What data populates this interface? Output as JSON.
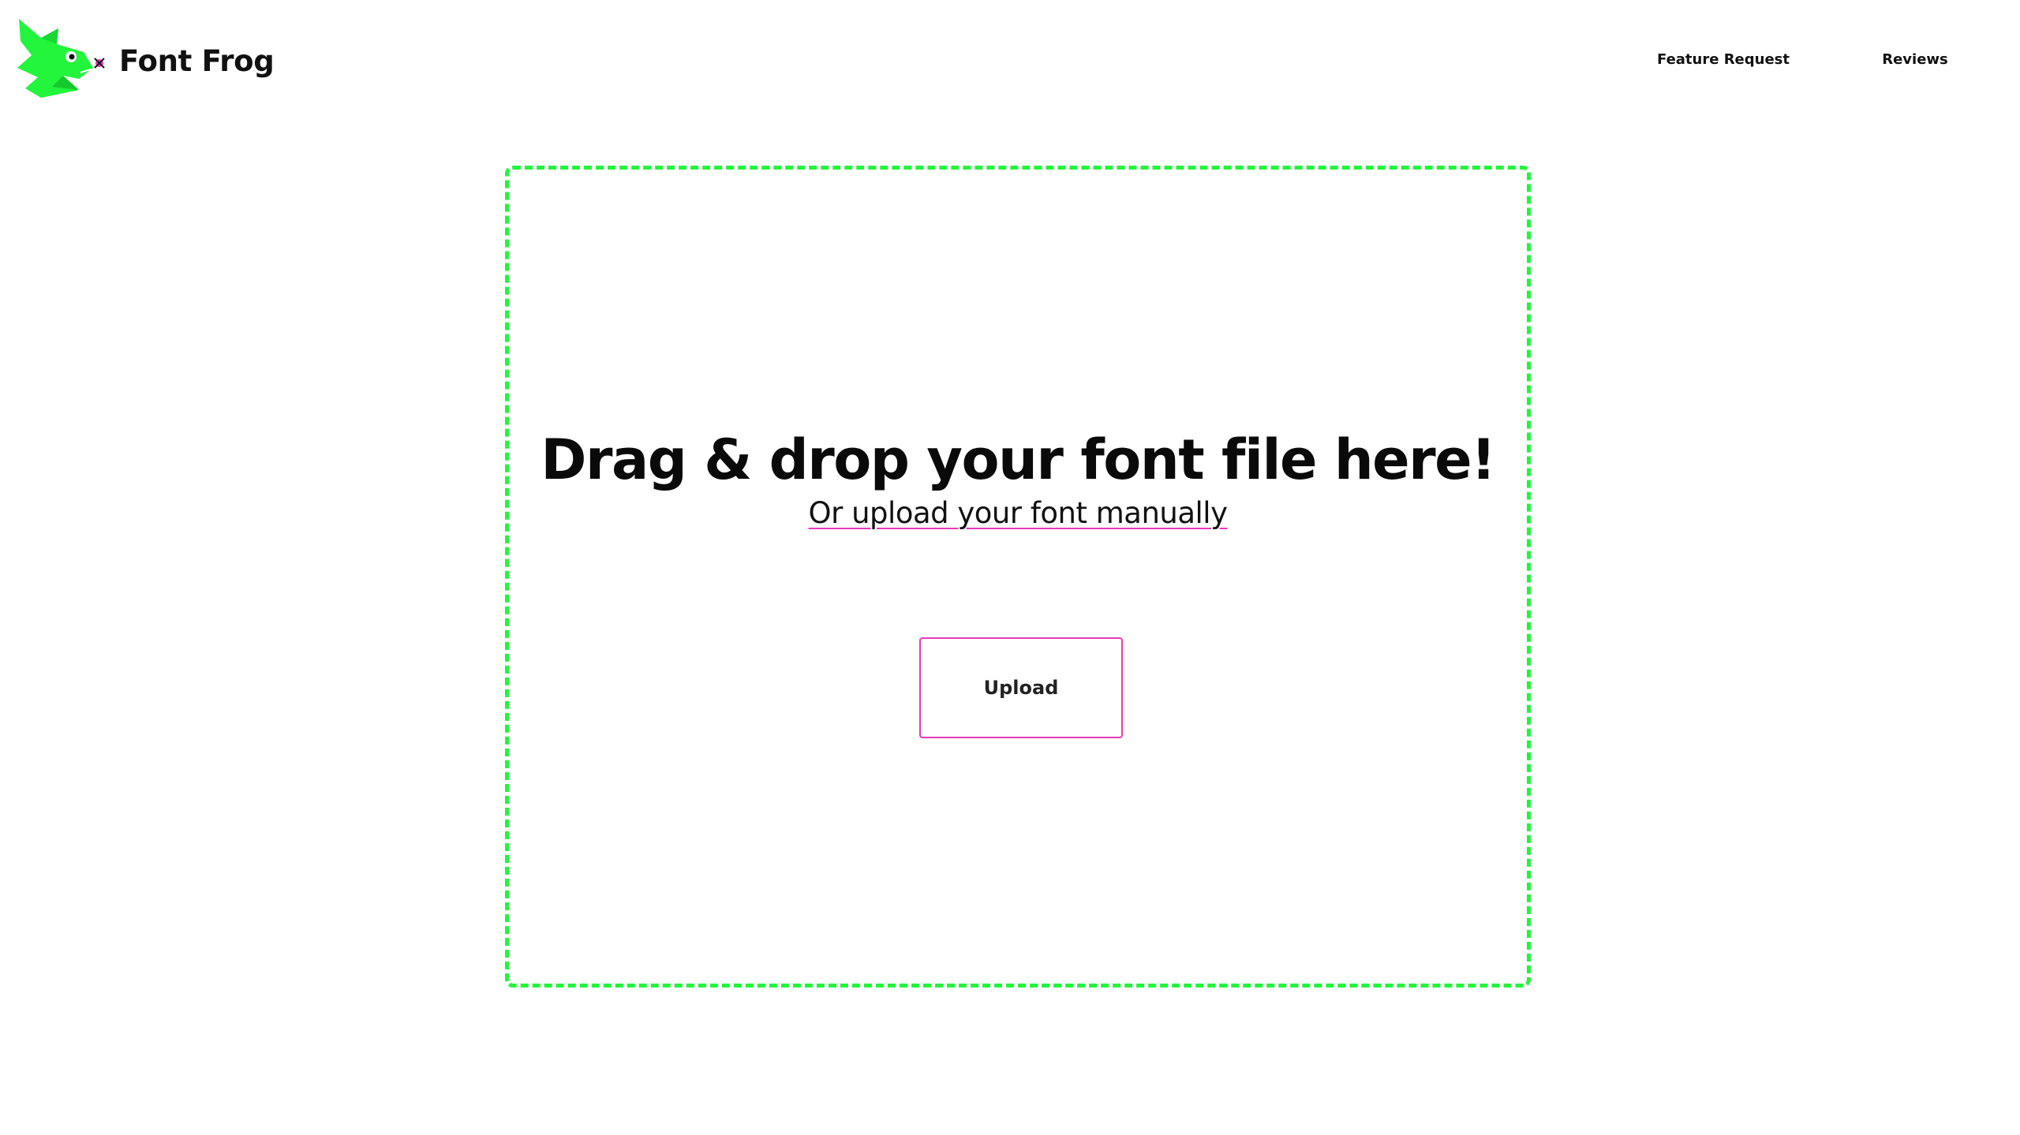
{
  "header": {
    "brand_name": "Font Frog",
    "logo_icon": "frog-logo-icon",
    "nav": [
      {
        "label": "Feature Request"
      },
      {
        "label": "Reviews"
      }
    ]
  },
  "dropzone": {
    "title": "Drag & drop your font file here!",
    "subtitle": "Or upload your font manually",
    "upload_button_label": "Upload"
  },
  "colors": {
    "brand_green": "#22f53c",
    "accent_pink": "#e83ab8",
    "text": "#111111",
    "background": "#ffffff"
  }
}
